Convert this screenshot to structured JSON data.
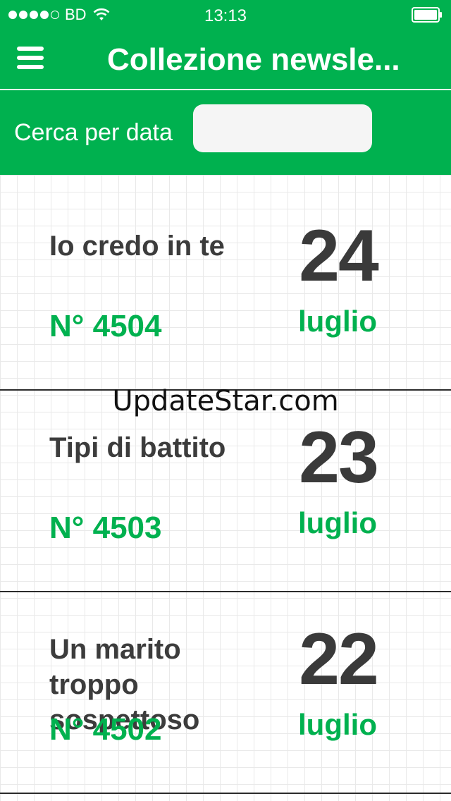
{
  "status_bar": {
    "carrier": "BD",
    "time": "13:13"
  },
  "header": {
    "title": "Collezione newsle..."
  },
  "search": {
    "label": "Cerca per data",
    "value": ""
  },
  "newsletters": [
    {
      "title": "Io credo in te",
      "number": "N° 4504",
      "day": "24",
      "month": "luglio"
    },
    {
      "title": "Tipi di battito",
      "number": "N° 4503",
      "day": "23",
      "month": "luglio"
    },
    {
      "title": "Un marito troppo sospettoso",
      "number": "N° 4502",
      "day": "22",
      "month": "luglio"
    }
  ],
  "watermark": "UpdateStar.com",
  "colors": {
    "brand": "#00b14f",
    "text_dark": "#3c3c3c"
  },
  "icons": {
    "menu": "hamburger-menu-icon",
    "wifi": "wifi-icon",
    "battery": "battery-icon"
  }
}
